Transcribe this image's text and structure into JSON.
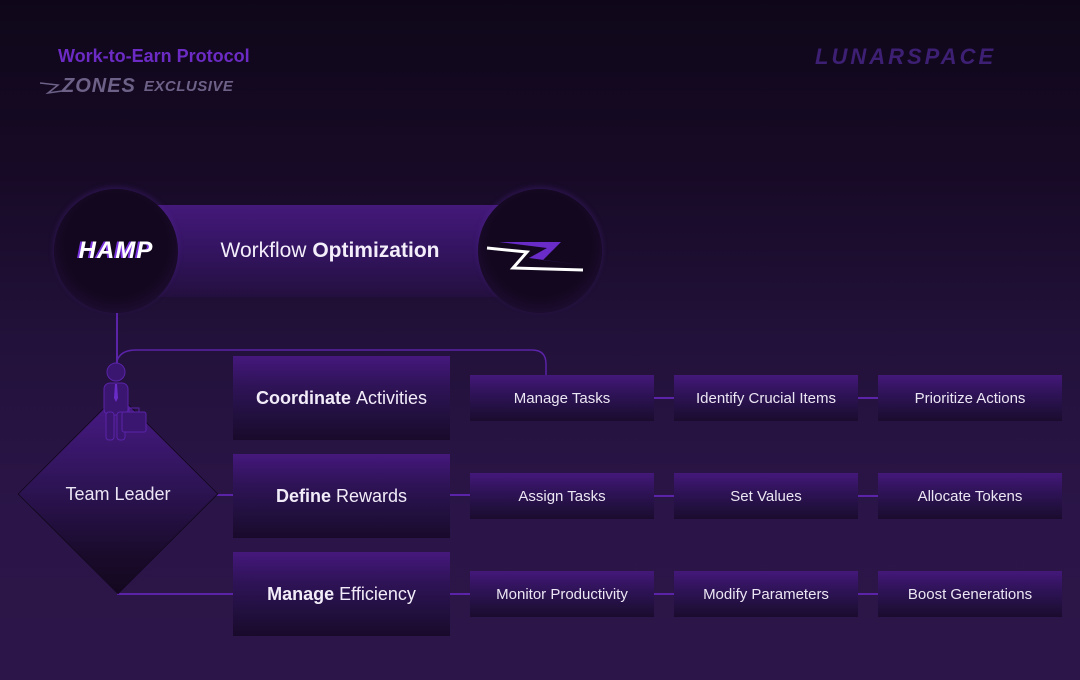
{
  "header": {
    "title": "Work-to-Earn Protocol",
    "zones_logo": "ZONES",
    "exclusive_label": "EXCLUSIVE",
    "brand": "LUNARSPACE"
  },
  "banner": {
    "left_logo": "HAMP",
    "title_regular": "Workflow",
    "title_bold": "Optimization",
    "right_icon": "lightning-z-icon"
  },
  "leader": {
    "label": "Team Leader",
    "icon": "businessman-icon"
  },
  "rows": [
    {
      "bold": "Coordinate",
      "regular": "Activities",
      "items": [
        "Manage Tasks",
        "Identify Crucial Items",
        "Prioritize Actions"
      ]
    },
    {
      "bold": "Define",
      "regular": "Rewards",
      "items": [
        "Assign Tasks",
        "Set Values",
        "Allocate Tokens"
      ]
    },
    {
      "bold": "Manage",
      "regular": "Efficiency",
      "items": [
        "Monitor Productivity",
        "Modify Parameters",
        "Boost Generations"
      ]
    }
  ],
  "colors": {
    "accent": "#6b2bc4",
    "line": "#5a23a8",
    "background_top": "#0f0719",
    "background_bottom": "#2c1649"
  }
}
